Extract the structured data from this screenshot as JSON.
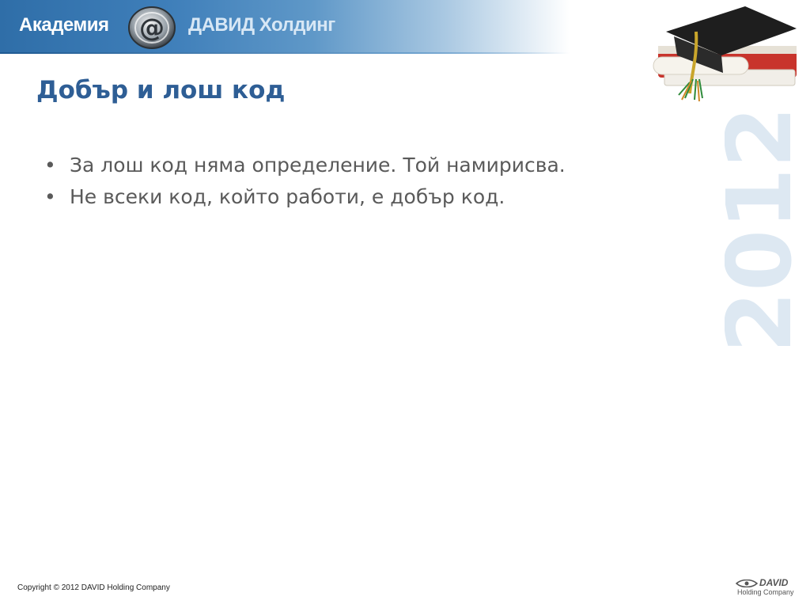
{
  "header": {
    "brand_left": "Академия",
    "brand_right": "ДАВИД Холдинг",
    "logo_symbol": "@"
  },
  "slide": {
    "title": "Добър и лош код",
    "bullets": [
      "За лош код няма определение. Той намирисва.",
      "Не всеки код, който работи, е добър код."
    ],
    "watermark_year": "2012"
  },
  "footer": {
    "copyright": "Copyright © 2012 DAVID Holding Company",
    "logo_word": "DAVID",
    "logo_sub": "Holding Company"
  },
  "colors": {
    "banner": "#3f7fba",
    "title": "#2e5e95",
    "body_text": "#5a5a5a",
    "watermark": "#dde8f2"
  }
}
